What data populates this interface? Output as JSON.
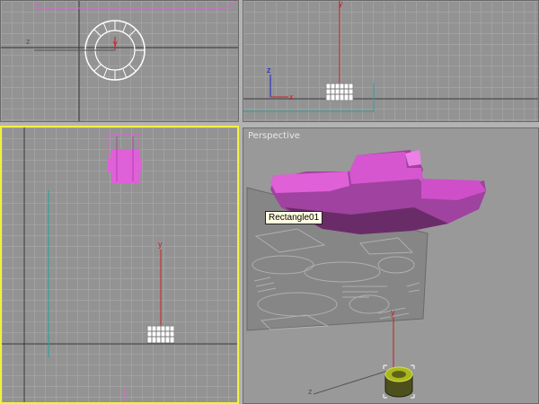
{
  "viewports": {
    "perspective": {
      "label": "Perspective",
      "tooltip": "Rectangle01"
    }
  },
  "axes": {
    "x": "x",
    "y": "y",
    "z": "z"
  },
  "colors": {
    "viewport_bg": "#939393",
    "grid_line": "#a1a1a1",
    "active_border": "#f5f03a",
    "selected_object": "#e060d8",
    "axis_red": "#c82020",
    "axis_green": "#1c9c1c",
    "axis_blue": "#2020c8",
    "tooltip_bg": "#fffde1"
  }
}
